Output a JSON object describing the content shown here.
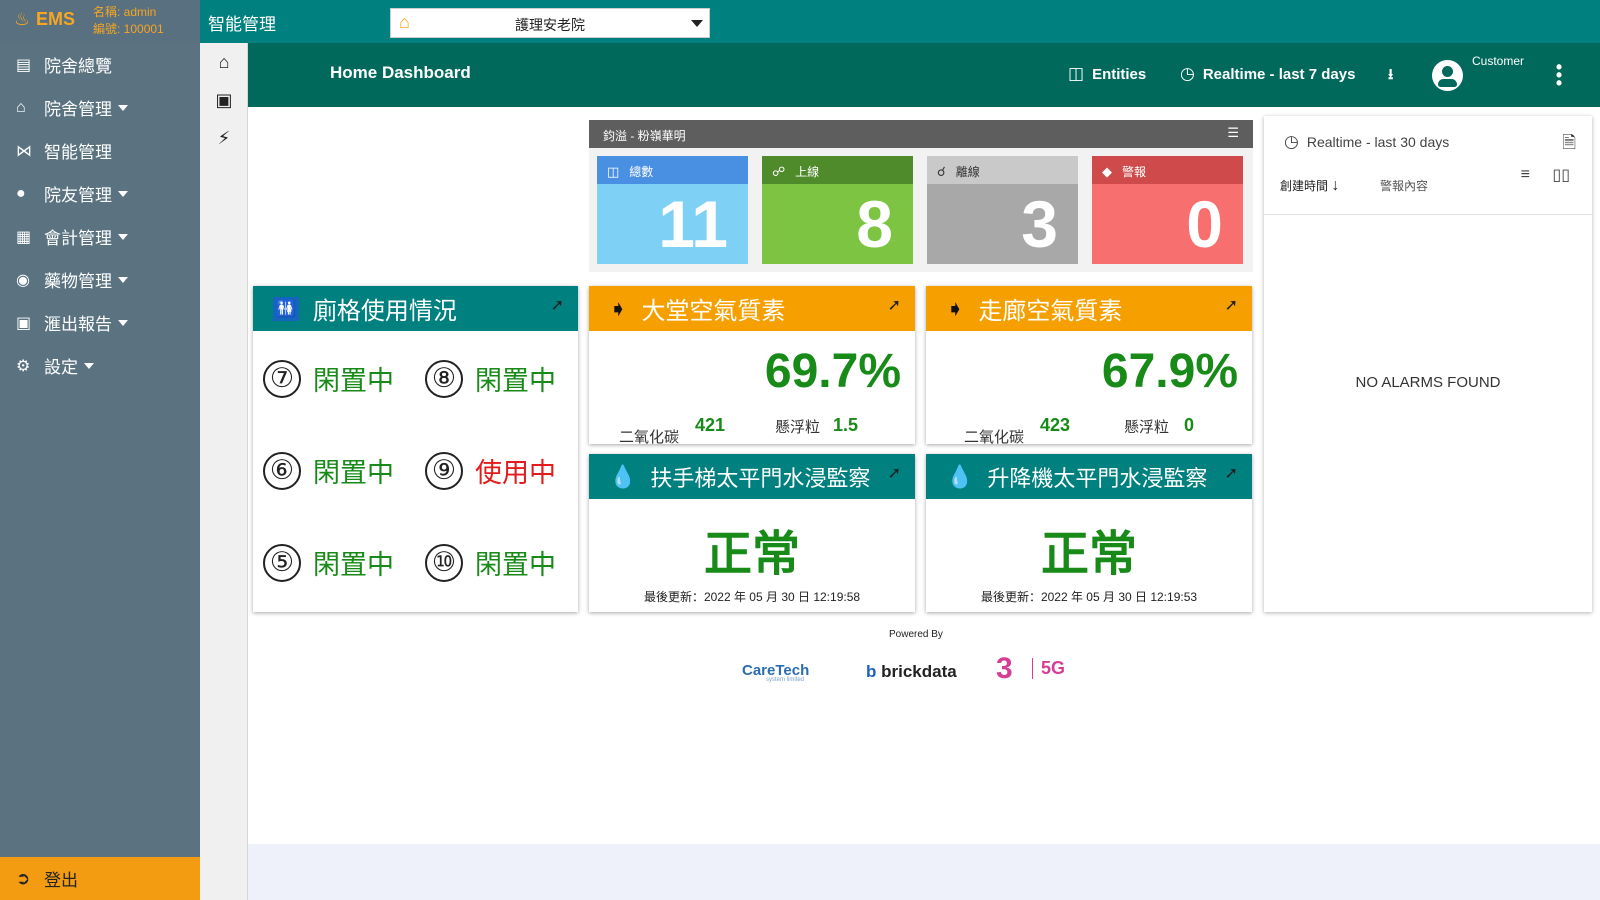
{
  "brand": {
    "logo": "EMS",
    "name_line": "名稱: admin",
    "id_line": "編號: 100001"
  },
  "topbar": {
    "section_title": "智能管理",
    "site_select": "護理安老院"
  },
  "sidebar": {
    "items": [
      {
        "label": "院舍總覽",
        "icon": "list-icon",
        "dropdown": false
      },
      {
        "label": "院舍管理",
        "icon": "home-icon",
        "dropdown": true
      },
      {
        "label": "智能管理",
        "icon": "antenna-icon",
        "dropdown": false
      },
      {
        "label": "院友管理",
        "icon": "user-icon",
        "dropdown": true
      },
      {
        "label": "會計管理",
        "icon": "calculator-icon",
        "dropdown": true
      },
      {
        "label": "藥物管理",
        "icon": "pills-icon",
        "dropdown": true
      },
      {
        "label": "滙出報告",
        "icon": "clipboard-icon",
        "dropdown": true
      },
      {
        "label": "設定",
        "icon": "gear-icon",
        "dropdown": true
      }
    ],
    "logout": "登出"
  },
  "dash_header": {
    "title": "Home Dashboard",
    "entities": "Entities",
    "timewindow": "Realtime - last 7 days",
    "customer": "Customer"
  },
  "stats": {
    "title": "鈞溢 - 粉嶺華明",
    "cards": [
      {
        "label": "總數",
        "value": "11"
      },
      {
        "label": "上線",
        "value": "8"
      },
      {
        "label": "離線",
        "value": "3"
      },
      {
        "label": "警報",
        "value": "0"
      }
    ]
  },
  "toilet": {
    "title": "廁格使用情況",
    "stalls": [
      {
        "num": "⑦",
        "status": "閑置中"
      },
      {
        "num": "⑧",
        "status": "閑置中"
      },
      {
        "num": "⑥",
        "status": "閑置中"
      },
      {
        "num": "⑨",
        "status": "使用中"
      },
      {
        "num": "⑤",
        "status": "閑置中"
      },
      {
        "num": "⑩",
        "status": "閑置中"
      }
    ]
  },
  "air": [
    {
      "title": "大堂空氣質素",
      "value": "69.7%",
      "co2_label": "二氧化碳",
      "co2": "421",
      "pm_label": "懸浮粒",
      "pm": "1.5"
    },
    {
      "title": "走廊空氣質素",
      "value": "67.9%",
      "co2_label": "二氧化碳",
      "co2": "423",
      "pm_label": "懸浮粒",
      "pm": "0"
    }
  ],
  "water": [
    {
      "title": "扶手梯太平門水浸監察",
      "status": "正常",
      "updated": "最後更新：2022 年 05 月 30 日 12:19:58"
    },
    {
      "title": "升降機太平門水浸監察",
      "status": "正常",
      "updated": "最後更新：2022 年 05 月 30 日 12:19:53"
    }
  ],
  "alarms": {
    "timewindow": "Realtime - last 30 days",
    "col_time": "創建時間",
    "col_content": "警報內容",
    "empty": "NO ALARMS FOUND"
  },
  "footer": {
    "powered": "Powered By",
    "logo_caretech": "CareTech",
    "logo_caretech_sub": "system limited",
    "logo_brickdata": "brickdata",
    "logo_three": "3",
    "logo_5g": "5G"
  },
  "colors": {
    "topbar": "#00807f",
    "header": "#00695c",
    "sidebar": "#5b7380",
    "accent": "#f39c12",
    "total": "#7fd0f5",
    "online": "#7cc441",
    "offline": "#a8a8a8",
    "alarm": "#f76f6f",
    "ok_green": "#178a17",
    "busy_red": "#e31b1b"
  }
}
